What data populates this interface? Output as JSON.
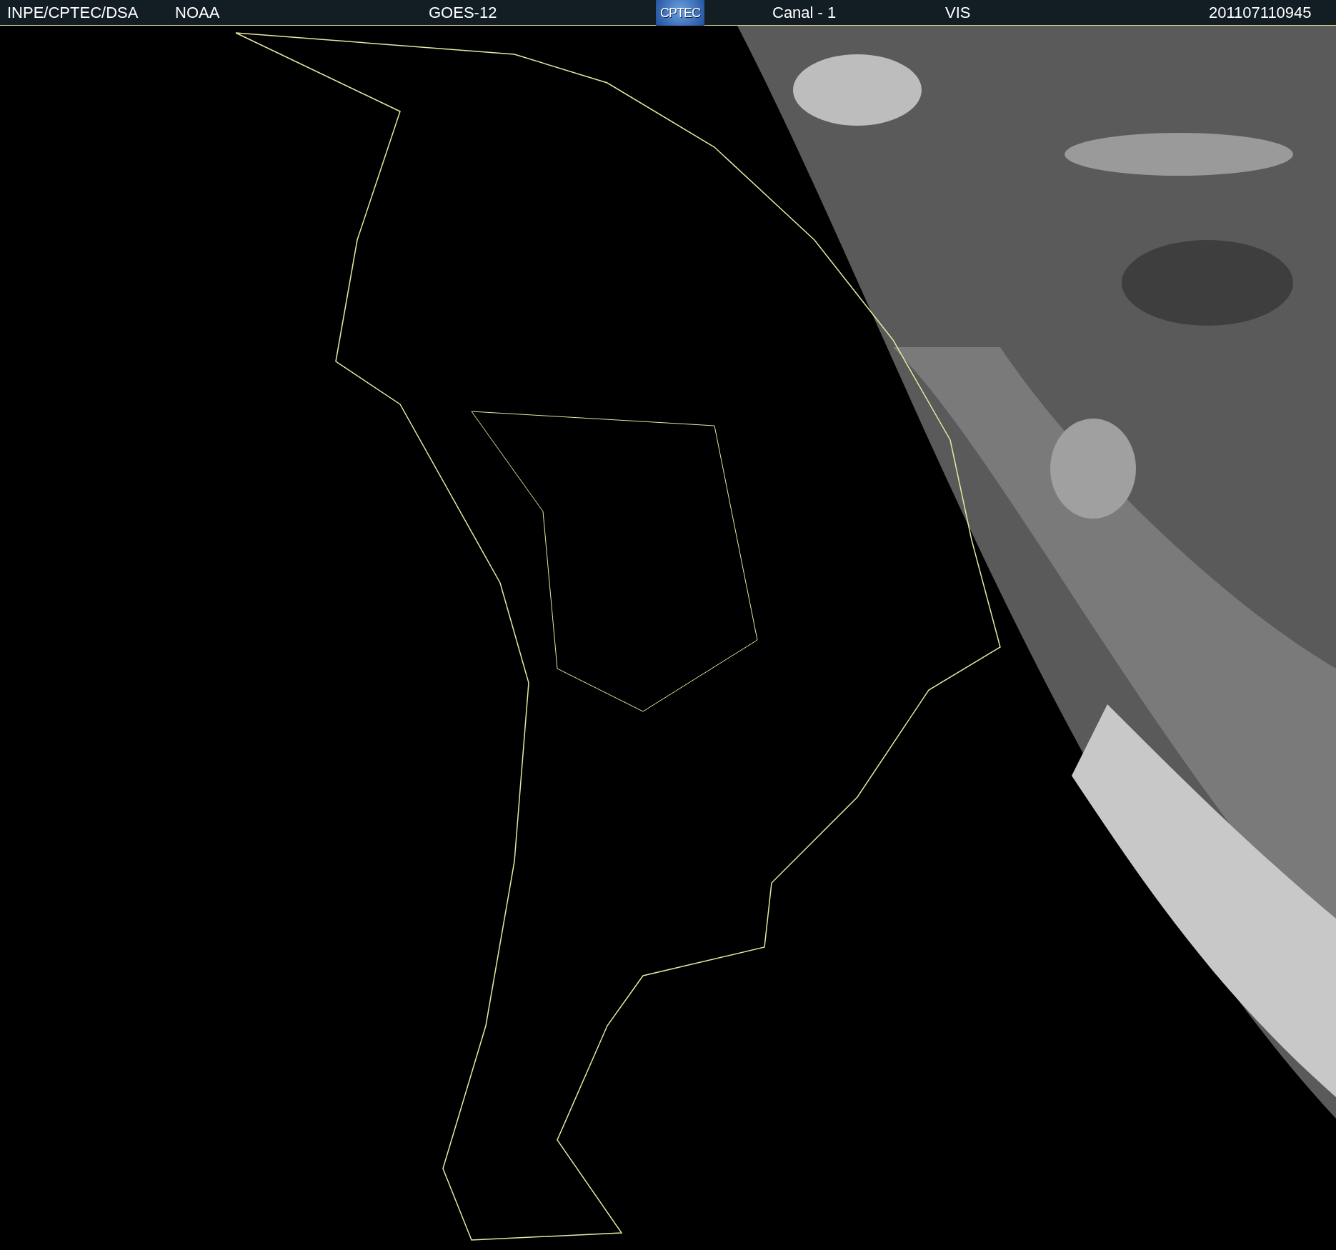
{
  "header": {
    "items": [
      {
        "kind": "text",
        "text": "INPE/CPTEC/DSA"
      },
      {
        "kind": "text",
        "text": "NOAA"
      },
      {
        "kind": "text",
        "text": "GOES-12"
      },
      {
        "kind": "logo",
        "text": "CPTEC"
      },
      {
        "kind": "text",
        "text": "Canal - 1"
      },
      {
        "kind": "text",
        "text": "VIS"
      },
      {
        "kind": "text",
        "text": "201107110945"
      }
    ]
  }
}
